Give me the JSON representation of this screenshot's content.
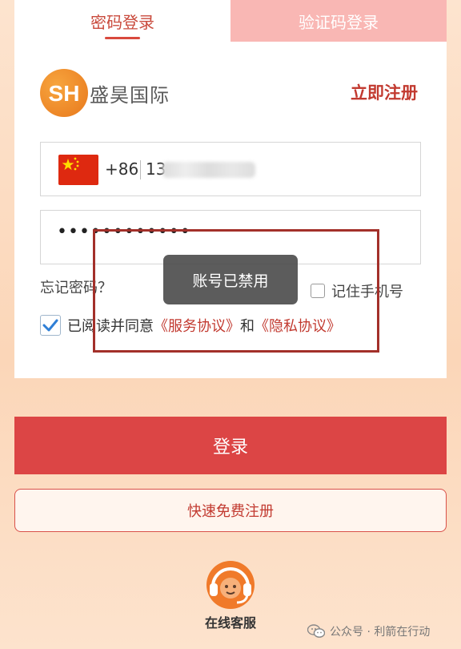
{
  "tabs": {
    "password_login": "密码登录",
    "code_login": "验证码登录"
  },
  "brand": {
    "logo_text": "SH",
    "name": "盛昊国际",
    "register_link": "立即注册"
  },
  "phone_field": {
    "country_code": "+86",
    "value_prefix": "13"
  },
  "password_field": {
    "masked_value": "••••••••••••"
  },
  "forgot_password": "忘记密码？",
  "remember_phone": {
    "label": "记住手机号",
    "checked": false
  },
  "agreement": {
    "checked": true,
    "prefix": "已阅读并同意",
    "service_link": "《服务协议》",
    "conjunction": "和",
    "privacy_link": "《隐私协议》"
  },
  "toast": {
    "message": "账号已禁用"
  },
  "buttons": {
    "login": "登录",
    "quick_register": "快速免费注册"
  },
  "customer_service": {
    "label": "在线客服"
  },
  "watermark": {
    "text": "公众号 · 利箭在行动"
  },
  "colors": {
    "accent_red": "#dc4545",
    "link_red": "#c23a30",
    "logo_orange": "#e8781c",
    "highlight_border": "#a3302a"
  }
}
